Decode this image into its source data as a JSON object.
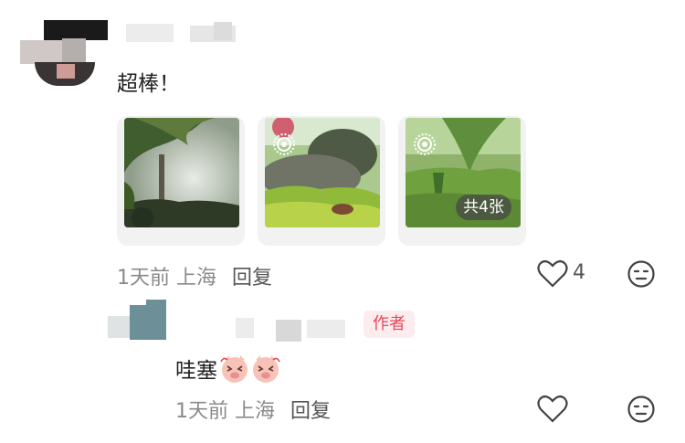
{
  "comment_main": {
    "text": "超棒！",
    "time": "1天前",
    "location": "上海",
    "reply_label": "回复",
    "like_count": "4",
    "images": [
      {
        "name": "misty-forest-photo"
      },
      {
        "name": "mossy-rock-photo",
        "live": true
      },
      {
        "name": "green-field-photo",
        "live": true,
        "count_badge": "共4张"
      }
    ]
  },
  "reply_comment": {
    "author_tag": "作者",
    "text": "哇塞",
    "emoji": [
      "cheering-pig-sticker",
      "cheering-pig-sticker"
    ],
    "time": "1天前",
    "location": "上海",
    "reply_label": "回复"
  },
  "colors": {
    "author_tag_text": "#e8485a",
    "author_tag_bg": "#fdecee"
  }
}
